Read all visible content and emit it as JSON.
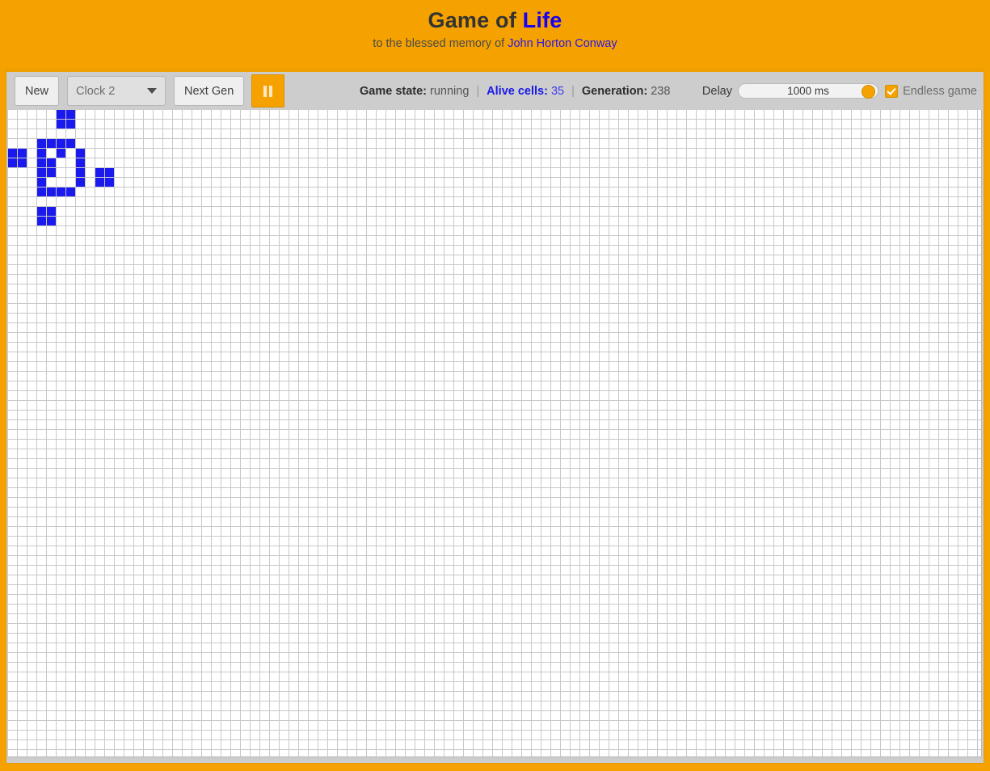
{
  "header": {
    "title_main": "Game of ",
    "title_accent": "Life",
    "subtitle_prefix": "to the blessed memory of ",
    "subtitle_person": "John Horton Conway"
  },
  "toolbar": {
    "new_label": "New",
    "pattern_select_value": "Clock 2",
    "next_gen_label": "Next Gen",
    "play_pause_icon": "pause-icon",
    "play_pause_state": "pause"
  },
  "status": {
    "game_state_label": "Game state:",
    "game_state_value": "running",
    "separator": "|",
    "alive_cells_label": "Alive cells:",
    "alive_cells_value": "35",
    "generation_label": "Generation:",
    "generation_value": "238"
  },
  "delay": {
    "label": "Delay",
    "value": "1000 ms"
  },
  "endless": {
    "label": "Endless game",
    "checked": true
  },
  "colors": {
    "brand_orange": "#f5a200",
    "cell_blue": "#1a1aee",
    "grid_line": "#c8c8c8",
    "toolbar_bg": "#cdcdcd"
  },
  "grid": {
    "cell_size": 12,
    "cols": 100,
    "rows": 66,
    "alive_cells": [
      [
        5,
        0
      ],
      [
        6,
        0
      ],
      [
        5,
        1
      ],
      [
        6,
        1
      ],
      [
        3,
        3
      ],
      [
        4,
        3
      ],
      [
        5,
        3
      ],
      [
        6,
        3
      ],
      [
        0,
        4
      ],
      [
        1,
        4
      ],
      [
        3,
        4
      ],
      [
        5,
        4
      ],
      [
        7,
        4
      ],
      [
        0,
        5
      ],
      [
        1,
        5
      ],
      [
        3,
        5
      ],
      [
        4,
        5
      ],
      [
        7,
        5
      ],
      [
        3,
        6
      ],
      [
        4,
        6
      ],
      [
        7,
        6
      ],
      [
        9,
        6
      ],
      [
        10,
        6
      ],
      [
        3,
        7
      ],
      [
        7,
        7
      ],
      [
        9,
        7
      ],
      [
        10,
        7
      ],
      [
        3,
        8
      ],
      [
        4,
        8
      ],
      [
        5,
        8
      ],
      [
        6,
        8
      ],
      [
        3,
        10
      ],
      [
        4,
        10
      ],
      [
        3,
        11
      ],
      [
        4,
        11
      ]
    ]
  }
}
